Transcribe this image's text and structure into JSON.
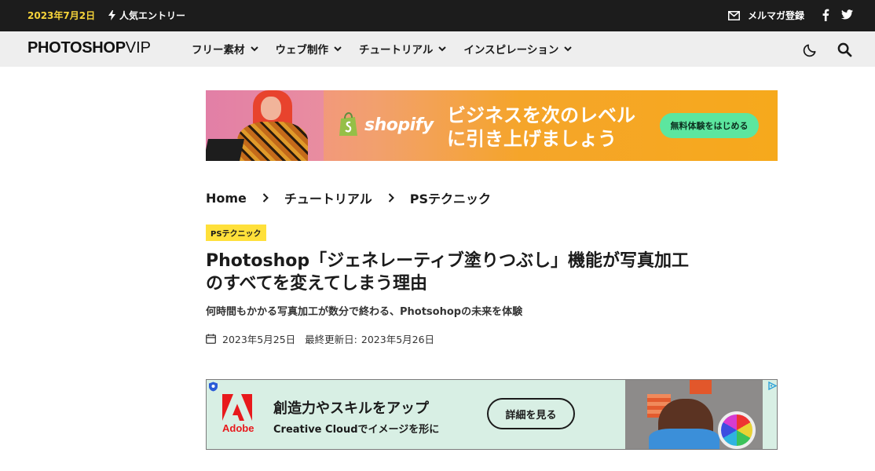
{
  "topbar": {
    "date": "2023年7月2日",
    "popular": "人気エントリー",
    "newsletter": "メルマガ登録"
  },
  "nav": {
    "logo_main": "PHOTOSHOP",
    "logo_suffix": "VIP",
    "items": [
      {
        "label": "フリー素材"
      },
      {
        "label": "ウェブ制作"
      },
      {
        "label": "チュートリアル"
      },
      {
        "label": "インスピレーション"
      }
    ]
  },
  "shopify_ad": {
    "brand": "shopify",
    "line1": "ビジネスを次のレベル",
    "line2": "に引き上げましょう",
    "cta": "無料体験をはじめる"
  },
  "breadcrumb": {
    "items": [
      "Home",
      "チュートリアル",
      "PSテクニック"
    ]
  },
  "article": {
    "tag": "PSテクニック",
    "title_line1": "Photoshop「ジェネレーティブ塗りつぶし」機能が写真加工",
    "title_line2": "のすべてを変えてしまう理由",
    "subtitle": "何時間もかかる写真加工が数分で終わる、Photsohopの未来を体験",
    "published": "2023年5月25日",
    "updated_label": "最終更新日:",
    "updated": "2023年5月26日"
  },
  "adobe_ad": {
    "brand": "Adobe",
    "headline": "創造力やスキルをアップ",
    "sub": "Creative Cloudでイメージを形に",
    "cta": "詳細を見る"
  },
  "colors": {
    "topbar_bg": "#1c1c1c",
    "date_accent": "#f5d33a",
    "nav_bg": "#eeeeee",
    "tag_bg": "#ffe03a",
    "shopify_cta": "#5ce69f",
    "adobe_red": "#e8191c",
    "adobe_bg": "#d8efe4"
  }
}
